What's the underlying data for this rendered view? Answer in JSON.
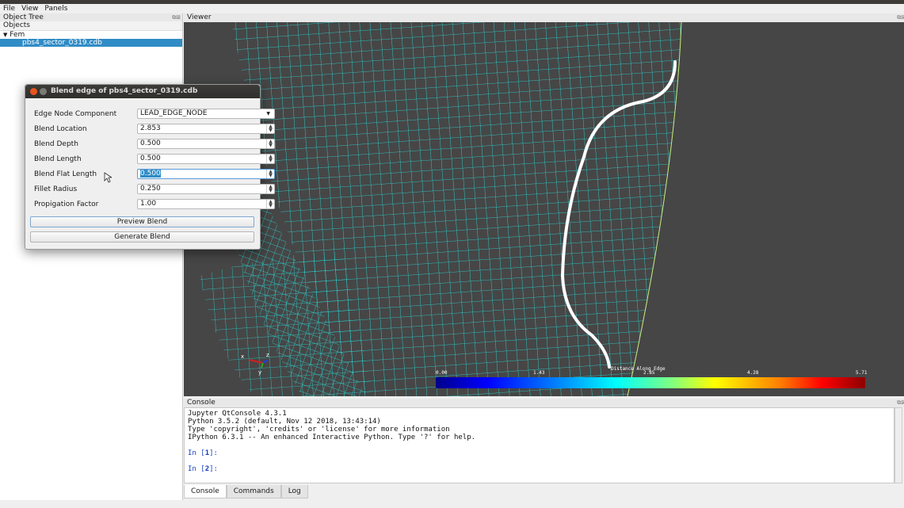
{
  "menu": [
    "File",
    "View",
    "Panels"
  ],
  "object_tree": {
    "title": "Object Tree",
    "header": "Objects",
    "root": "Fem",
    "selected_item": "pbs4_sector_0319.cdb",
    "root_arrow": "triangle-down-icon"
  },
  "viewer": {
    "title": "Viewer",
    "colorbar": {
      "title": "Distance Along Edge",
      "ticks": [
        "0.00",
        "1.43",
        "2.85",
        "4.28",
        "5.71"
      ],
      "colors": [
        "#00008b",
        "#0000ff",
        "#0080ff",
        "#00ffff",
        "#80ff80",
        "#ffff00",
        "#ff8000",
        "#ff0000",
        "#8b0000"
      ]
    },
    "axes": [
      "x",
      "y",
      "z"
    ]
  },
  "dialog": {
    "title": "Blend edge of pbs4_sector_0319.cdb",
    "fields": [
      {
        "label": "Edge Node Component",
        "value": "LEAD_EDGE_NODE",
        "type": "combo"
      },
      {
        "label": "Blend Location",
        "value": "2.853",
        "type": "spin"
      },
      {
        "label": "Blend Depth",
        "value": "0.500",
        "type": "spin"
      },
      {
        "label": "Blend Length",
        "value": "0.500",
        "type": "spin"
      },
      {
        "label": "Blend Flat Length",
        "value": "0.500",
        "type": "spin"
      },
      {
        "label": "Fillet Radius",
        "value": "0.250",
        "type": "spin"
      },
      {
        "label": "Propigation Factor",
        "value": "1.00",
        "type": "spin"
      }
    ],
    "preview_button": "Preview Blend",
    "generate_button": "Generate Blend"
  },
  "console": {
    "title": "Console",
    "lines": [
      "Jupyter QtConsole 4.3.1",
      "Python 3.5.2 (default, Nov 12 2018, 13:43:14)",
      "Type 'copyright', 'credits' or 'license' for more information",
      "IPython 6.3.1 -- An enhanced Interactive Python. Type '?' for help."
    ],
    "prompts": [
      {
        "prefix": "In [",
        "num": "1",
        "suffix": "]:"
      },
      {
        "prefix": "In [",
        "num": "2",
        "suffix": "]:"
      }
    ]
  },
  "tabs": [
    "Console",
    "Commands",
    "Log"
  ],
  "colors": {
    "selection": "#308cc6",
    "mesh": "#27e0e0",
    "background": "#464646"
  }
}
